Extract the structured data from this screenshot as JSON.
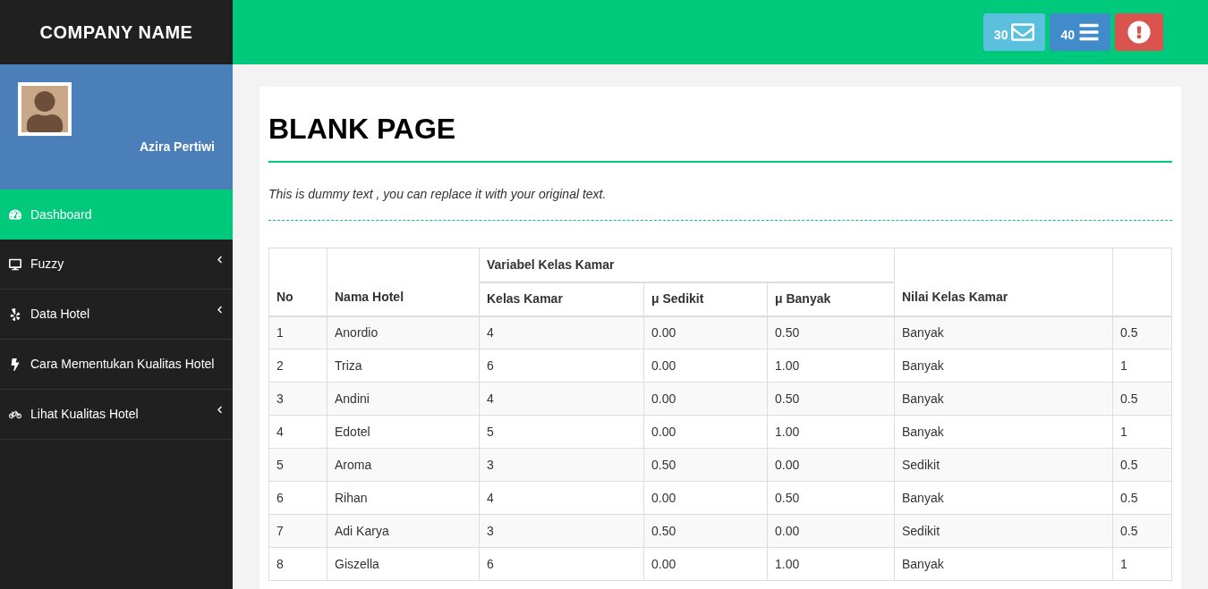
{
  "brand": "COMPANY NAME",
  "notifications": [
    {
      "kind": "mail",
      "count": "30",
      "color": "#5bc0de"
    },
    {
      "kind": "tasks",
      "count": "40",
      "color": "#428bca"
    },
    {
      "kind": "alert",
      "color": "#d9534f"
    }
  ],
  "user": {
    "name": "Azira Pertiwi"
  },
  "sidebar": {
    "items": [
      {
        "label": "Dashboard",
        "selected": true,
        "has_submenu": false
      },
      {
        "label": "Fuzzy",
        "selected": false,
        "has_submenu": true
      },
      {
        "label": "Data Hotel",
        "selected": false,
        "has_submenu": true
      },
      {
        "label": "Cara Mementukan Kualitas Hotel",
        "selected": false,
        "has_submenu": false
      },
      {
        "label": "Lihat Kualitas Hotel",
        "selected": false,
        "has_submenu": true
      }
    ]
  },
  "page": {
    "title": "BLANK PAGE",
    "subtitle": "This is dummy text , you can replace it with your original text."
  },
  "table": {
    "columns": {
      "no": "No",
      "name": "Nama Hotel",
      "group": "Variabel Kelas Kamar",
      "class": "Kelas Kamar",
      "low": "μ Sedikit",
      "high": "μ Banyak",
      "value": "Nilai Kelas Kamar"
    },
    "rows": [
      [
        "1",
        "Anordio",
        "4",
        "0.00",
        "0.50",
        "Banyak",
        "0.5"
      ],
      [
        "2",
        "Triza",
        "6",
        "0.00",
        "1.00",
        "Banyak",
        "1"
      ],
      [
        "3",
        "Andini",
        "4",
        "0.00",
        "0.50",
        "Banyak",
        "0.5"
      ],
      [
        "4",
        "Edotel",
        "5",
        "0.00",
        "1.00",
        "Banyak",
        "1"
      ],
      [
        "5",
        "Aroma",
        "3",
        "0.50",
        "0.00",
        "Sedikit",
        "0.5"
      ],
      [
        "6",
        "Rihan",
        "4",
        "0.00",
        "0.50",
        "Banyak",
        "0.5"
      ],
      [
        "7",
        "Adi Karya",
        "3",
        "0.50",
        "0.00",
        "Sedikit",
        "0.5"
      ],
      [
        "8",
        "Giszella",
        "6",
        "0.00",
        "1.00",
        "Banyak",
        "1"
      ]
    ]
  }
}
